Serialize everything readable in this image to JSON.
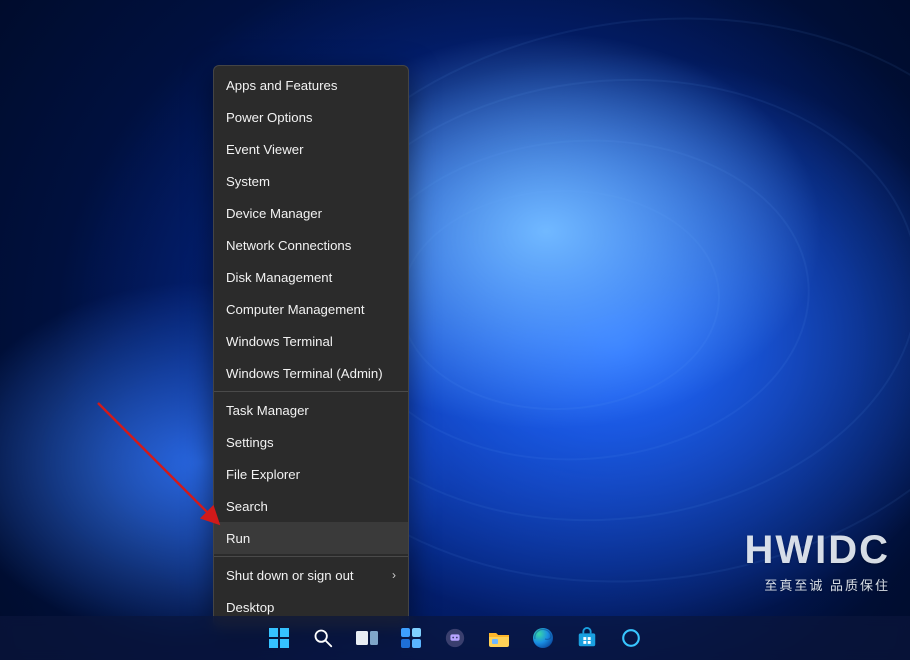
{
  "contextMenu": {
    "groups": [
      [
        {
          "label": "Apps and Features"
        },
        {
          "label": "Power Options"
        },
        {
          "label": "Event Viewer"
        },
        {
          "label": "System"
        },
        {
          "label": "Device Manager"
        },
        {
          "label": "Network Connections"
        },
        {
          "label": "Disk Management"
        },
        {
          "label": "Computer Management"
        },
        {
          "label": "Windows Terminal"
        },
        {
          "label": "Windows Terminal (Admin)"
        }
      ],
      [
        {
          "label": "Task Manager"
        },
        {
          "label": "Settings"
        },
        {
          "label": "File Explorer"
        },
        {
          "label": "Search"
        },
        {
          "label": "Run",
          "highlight": true
        }
      ],
      [
        {
          "label": "Shut down or sign out",
          "submenu": true
        },
        {
          "label": "Desktop"
        }
      ]
    ]
  },
  "annotation": {
    "arrow_color": "#d11a1a"
  },
  "watermark": {
    "title": "HWIDC",
    "subtitle": "至真至诚  品质保住"
  },
  "taskbarIcons": [
    "start",
    "search",
    "task-view",
    "widgets",
    "chat",
    "file-explorer",
    "edge",
    "store",
    "cortana"
  ]
}
